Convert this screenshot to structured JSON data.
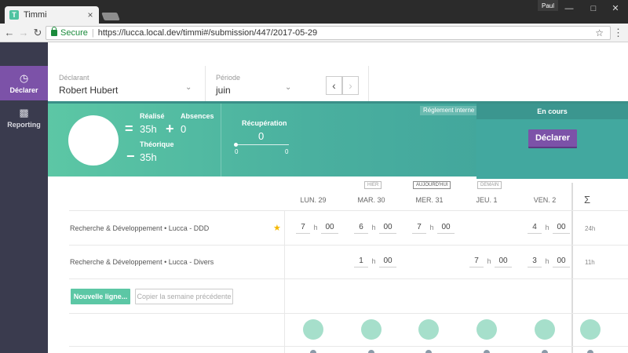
{
  "browser": {
    "tab_title": "Timmi",
    "tab_close": "×",
    "user": "Paul",
    "secure_label": "Secure",
    "url": "https://lucca.local.dev/timmi#/submission/447/2017-05-29"
  },
  "sidebar": {
    "items": [
      {
        "label": "Déclarer",
        "icon": "clock-icon",
        "active": true
      },
      {
        "label": "Reporting",
        "icon": "bar-chart-icon",
        "active": false
      }
    ]
  },
  "header": {
    "declarant_label": "Déclarant",
    "declarant_value": "Robert Hubert",
    "periode_label": "Période",
    "periode_value": "juin"
  },
  "summary": {
    "realise_label": "Réalisé",
    "realise_value": "35h",
    "absences_label": "Absences",
    "absences_value": "0",
    "theorique_label": "Théorique",
    "theorique_value": "35h",
    "recuperation_label": "Récupération",
    "recuperation_value": "0",
    "recuperation_min": "0",
    "recuperation_max": "0",
    "reglement_label": "Réglement interne",
    "status_label": "En cours",
    "declarer_button": "Déclarer",
    "accent_color": "#7c52a8",
    "band_color": "#4ab09f"
  },
  "timesheet": {
    "day_tags": [
      "HIER",
      "AUJOURD'HUI",
      "DEMAIN"
    ],
    "days": [
      "LUN. 29",
      "MAR. 30",
      "MER. 31",
      "JEU. 1",
      "VEN. 2"
    ],
    "sigma": "Σ",
    "h": "h",
    "rows": [
      {
        "label": "Recherche & Développement • Lucca - DDD",
        "cells": [
          {
            "h": "7",
            "m": "00"
          },
          {
            "h": "6",
            "m": "00"
          },
          {
            "h": "7",
            "m": "00"
          },
          {
            "h": "4",
            "m": "00"
          }
        ],
        "total": "24h"
      },
      {
        "label": "Recherche & Développement • Lucca - Divers",
        "cells": [
          {
            "h": "1",
            "m": "00"
          },
          {
            "h": "7",
            "m": "00"
          },
          {
            "h": "3",
            "m": "00"
          }
        ],
        "total": "11h"
      }
    ],
    "new_line_button": "Nouvelle ligne...",
    "copy_week_button": "Copier la semaine précédente"
  }
}
